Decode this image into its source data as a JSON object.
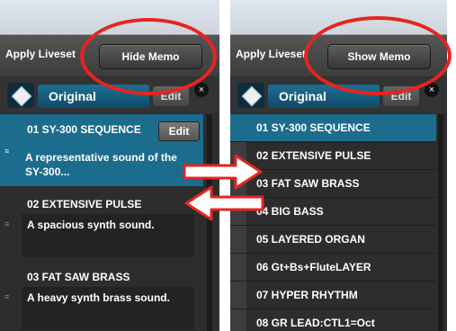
{
  "left_panel": {
    "apply_label": "Apply Liveset",
    "memo_toggle_label": "Hide Memo",
    "set_name": "Original",
    "set_edit_label": "Edit",
    "close_glyph": "×",
    "items": [
      {
        "title": "01  SY-300 SEQUENCE",
        "memo": "A representative sound of the SY-300...",
        "edit_label": "Edit"
      },
      {
        "title": "02  EXTENSIVE PULSE",
        "memo": "A spacious synth sound."
      },
      {
        "title": "03  FAT SAW BRASS",
        "memo": "A heavy synth brass sound."
      }
    ]
  },
  "right_panel": {
    "apply_label": "Apply Liveset",
    "memo_toggle_label": "Show Memo",
    "set_name": "Original",
    "set_edit_label": "Edit",
    "close_glyph": "×",
    "items": [
      "01  SY-300 SEQUENCE",
      "02  EXTENSIVE PULSE",
      "03  FAT SAW BRASS",
      "04  BIG BASS",
      "05  LAYERED ORGAN",
      "06  Gt+Bs+FluteLAYER",
      "07  HYPER RHYTHM",
      "08  GR LEAD:CTL1=Oct"
    ]
  },
  "colors": {
    "highlight": "#e52521",
    "selected": "#1b6c8d"
  }
}
